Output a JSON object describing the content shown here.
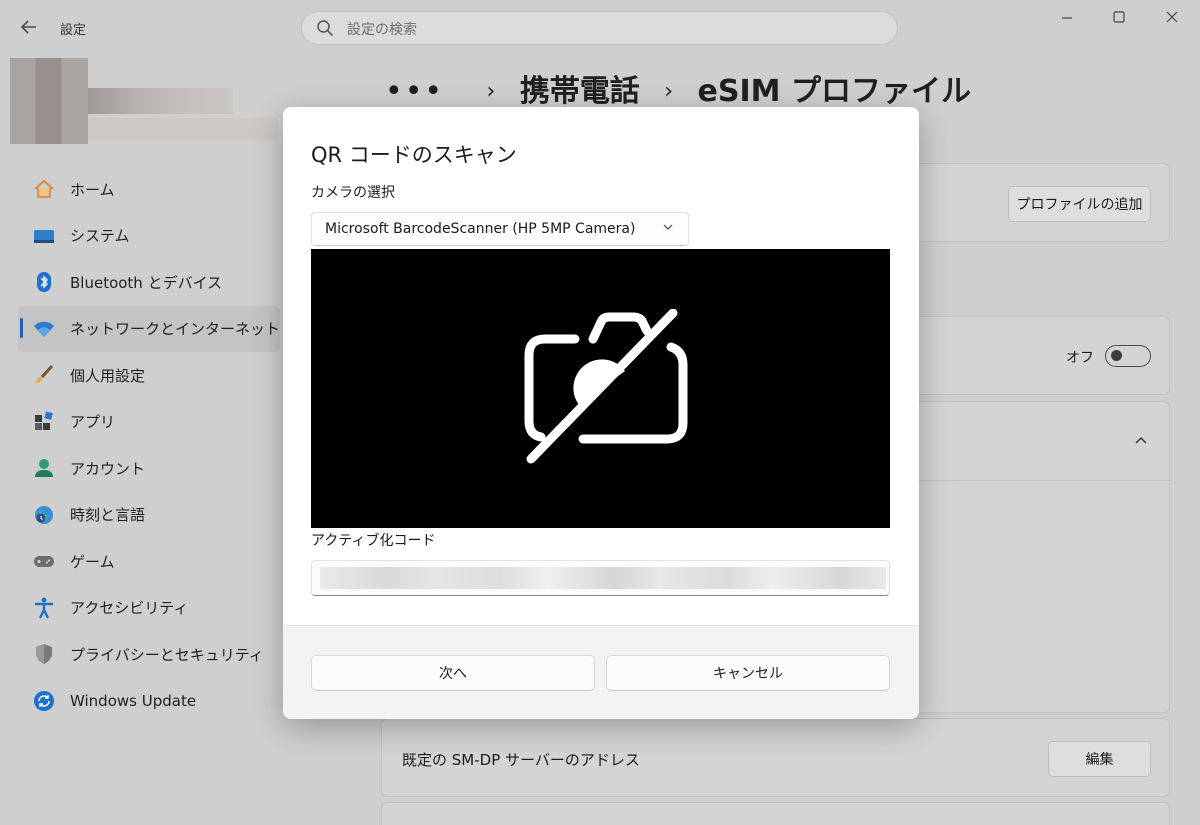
{
  "window": {
    "title": "設定",
    "back_icon": "back-arrow-icon"
  },
  "search": {
    "placeholder": "設定の検索"
  },
  "sidebar": {
    "items": [
      {
        "label": "ホーム",
        "icon": "home-icon"
      },
      {
        "label": "システム",
        "icon": "system-icon"
      },
      {
        "label": "Bluetooth とデバイス",
        "icon": "bluetooth-icon"
      },
      {
        "label": "ネットワークとインターネット",
        "icon": "wifi-icon",
        "active": true
      },
      {
        "label": "個人用設定",
        "icon": "brush-icon"
      },
      {
        "label": "アプリ",
        "icon": "apps-icon"
      },
      {
        "label": "アカウント",
        "icon": "account-icon"
      },
      {
        "label": "時刻と言語",
        "icon": "globe-icon"
      },
      {
        "label": "ゲーム",
        "icon": "gamepad-icon"
      },
      {
        "label": "アクセシビリティ",
        "icon": "accessibility-icon"
      },
      {
        "label": "プライバシーとセキュリティ",
        "icon": "shield-icon"
      },
      {
        "label": "Windows Update",
        "icon": "update-icon"
      }
    ]
  },
  "breadcrumb": {
    "more": "•••",
    "parent": "携帯電話",
    "current": "eSIM プロファイル"
  },
  "main": {
    "add_profile_button": "プロファイルの追加",
    "toggle_state": "オフ",
    "smdp_label": "既定の SM-DP サーバーのアドレス",
    "edit_button": "編集"
  },
  "dialog": {
    "title": "QR コードのスキャン",
    "camera_label": "カメラの選択",
    "camera_selected": "Microsoft BarcodeScanner (HP 5MP Camera)",
    "activation_label": "アクティブ化コード",
    "next_button": "次へ",
    "cancel_button": "キャンセル"
  },
  "colors": {
    "accent": "#1f5fb5",
    "camera_bg": "#000000",
    "dialog_bg": "#ffffff"
  }
}
